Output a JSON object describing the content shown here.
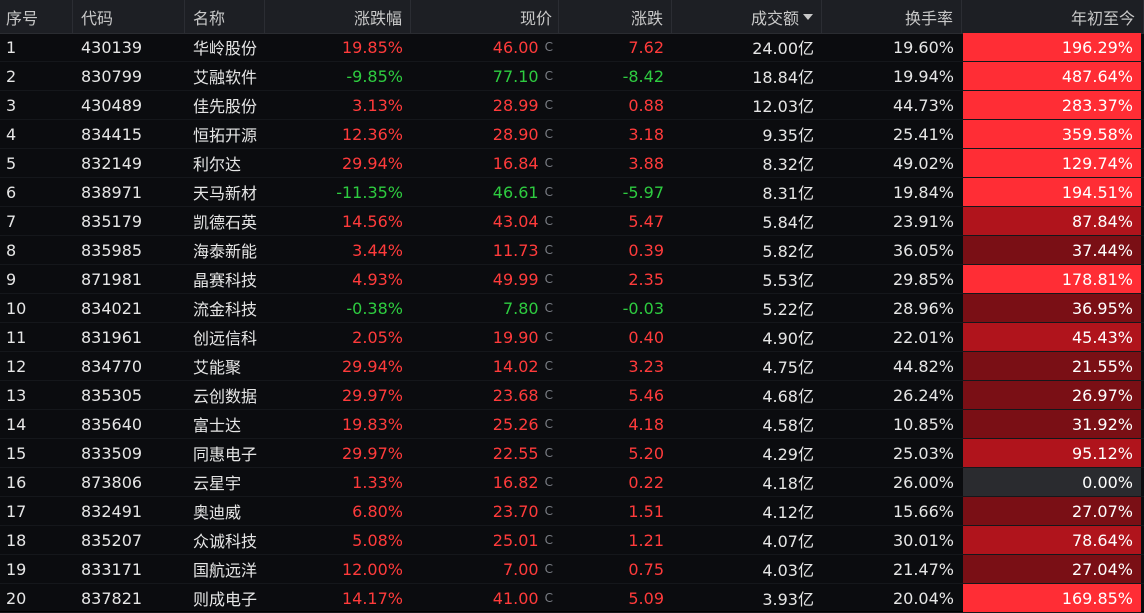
{
  "headers": {
    "idx": "序号",
    "code": "代码",
    "name": "名称",
    "pct": "涨跌幅",
    "price": "现价",
    "chg": "涨跌",
    "vol": "成交额",
    "turn": "换手率",
    "ytd": "年初至今"
  },
  "price_marker": "C",
  "colors": {
    "up": "#ff3b3b",
    "down": "#2ecc40",
    "ytd_strong": "#ff2d35",
    "ytd_mid": "#b0141c",
    "ytd_low": "#7a0f15",
    "ytd_zero": "#2a2b2f"
  },
  "rows": [
    {
      "idx": "1",
      "code": "430139",
      "name": "华岭股份",
      "pct": "19.85%",
      "price": "46.00",
      "chg": "7.62",
      "vol": "24.00亿",
      "turn": "19.60%",
      "ytd": "196.29%",
      "dir": "up",
      "heat": "strong"
    },
    {
      "idx": "2",
      "code": "830799",
      "name": "艾融软件",
      "pct": "-9.85%",
      "price": "77.10",
      "chg": "-8.42",
      "vol": "18.84亿",
      "turn": "19.94%",
      "ytd": "487.64%",
      "dir": "down",
      "heat": "strong"
    },
    {
      "idx": "3",
      "code": "430489",
      "name": "佳先股份",
      "pct": "3.13%",
      "price": "28.99",
      "chg": "0.88",
      "vol": "12.03亿",
      "turn": "44.73%",
      "ytd": "283.37%",
      "dir": "up",
      "heat": "strong"
    },
    {
      "idx": "4",
      "code": "834415",
      "name": "恒拓开源",
      "pct": "12.36%",
      "price": "28.90",
      "chg": "3.18",
      "vol": "9.35亿",
      "turn": "25.41%",
      "ytd": "359.58%",
      "dir": "up",
      "heat": "strong"
    },
    {
      "idx": "5",
      "code": "832149",
      "name": "利尔达",
      "pct": "29.94%",
      "price": "16.84",
      "chg": "3.88",
      "vol": "8.32亿",
      "turn": "49.02%",
      "ytd": "129.74%",
      "dir": "up",
      "heat": "strong"
    },
    {
      "idx": "6",
      "code": "838971",
      "name": "天马新材",
      "pct": "-11.35%",
      "price": "46.61",
      "chg": "-5.97",
      "vol": "8.31亿",
      "turn": "19.84%",
      "ytd": "194.51%",
      "dir": "down",
      "heat": "strong"
    },
    {
      "idx": "7",
      "code": "835179",
      "name": "凯德石英",
      "pct": "14.56%",
      "price": "43.04",
      "chg": "5.47",
      "vol": "5.84亿",
      "turn": "23.91%",
      "ytd": "87.84%",
      "dir": "up",
      "heat": "mid"
    },
    {
      "idx": "8",
      "code": "835985",
      "name": "海泰新能",
      "pct": "3.44%",
      "price": "11.73",
      "chg": "0.39",
      "vol": "5.82亿",
      "turn": "36.05%",
      "ytd": "37.44%",
      "dir": "up",
      "heat": "low"
    },
    {
      "idx": "9",
      "code": "871981",
      "name": "晶赛科技",
      "pct": "4.93%",
      "price": "49.99",
      "chg": "2.35",
      "vol": "5.53亿",
      "turn": "29.85%",
      "ytd": "178.81%",
      "dir": "up",
      "heat": "strong"
    },
    {
      "idx": "10",
      "code": "834021",
      "name": "流金科技",
      "pct": "-0.38%",
      "price": "7.80",
      "chg": "-0.03",
      "vol": "5.22亿",
      "turn": "28.96%",
      "ytd": "36.95%",
      "dir": "down",
      "heat": "low"
    },
    {
      "idx": "11",
      "code": "831961",
      "name": "创远信科",
      "pct": "2.05%",
      "price": "19.90",
      "chg": "0.40",
      "vol": "4.90亿",
      "turn": "22.01%",
      "ytd": "45.43%",
      "dir": "up",
      "heat": "mid"
    },
    {
      "idx": "12",
      "code": "834770",
      "name": "艾能聚",
      "pct": "29.94%",
      "price": "14.02",
      "chg": "3.23",
      "vol": "4.75亿",
      "turn": "44.82%",
      "ytd": "21.55%",
      "dir": "up",
      "heat": "low"
    },
    {
      "idx": "13",
      "code": "835305",
      "name": "云创数据",
      "pct": "29.97%",
      "price": "23.68",
      "chg": "5.46",
      "vol": "4.68亿",
      "turn": "26.24%",
      "ytd": "26.97%",
      "dir": "up",
      "heat": "low"
    },
    {
      "idx": "14",
      "code": "835640",
      "name": "富士达",
      "pct": "19.83%",
      "price": "25.26",
      "chg": "4.18",
      "vol": "4.58亿",
      "turn": "10.85%",
      "ytd": "31.92%",
      "dir": "up",
      "heat": "low"
    },
    {
      "idx": "15",
      "code": "833509",
      "name": "同惠电子",
      "pct": "29.97%",
      "price": "22.55",
      "chg": "5.20",
      "vol": "4.29亿",
      "turn": "25.03%",
      "ytd": "95.12%",
      "dir": "up",
      "heat": "mid"
    },
    {
      "idx": "16",
      "code": "873806",
      "name": "云星宇",
      "pct": "1.33%",
      "price": "16.82",
      "chg": "0.22",
      "vol": "4.18亿",
      "turn": "26.00%",
      "ytd": "0.00%",
      "dir": "up",
      "heat": "zero"
    },
    {
      "idx": "17",
      "code": "832491",
      "name": "奥迪威",
      "pct": "6.80%",
      "price": "23.70",
      "chg": "1.51",
      "vol": "4.12亿",
      "turn": "15.66%",
      "ytd": "27.07%",
      "dir": "up",
      "heat": "low"
    },
    {
      "idx": "18",
      "code": "835207",
      "name": "众诚科技",
      "pct": "5.08%",
      "price": "25.01",
      "chg": "1.21",
      "vol": "4.07亿",
      "turn": "30.01%",
      "ytd": "78.64%",
      "dir": "up",
      "heat": "mid"
    },
    {
      "idx": "19",
      "code": "833171",
      "name": "国航远洋",
      "pct": "12.00%",
      "price": "7.00",
      "chg": "0.75",
      "vol": "4.03亿",
      "turn": "21.47%",
      "ytd": "27.04%",
      "dir": "up",
      "heat": "low"
    },
    {
      "idx": "20",
      "code": "837821",
      "name": "则成电子",
      "pct": "14.17%",
      "price": "41.00",
      "chg": "5.09",
      "vol": "3.93亿",
      "turn": "20.04%",
      "ytd": "169.85%",
      "dir": "up",
      "heat": "strong"
    }
  ]
}
